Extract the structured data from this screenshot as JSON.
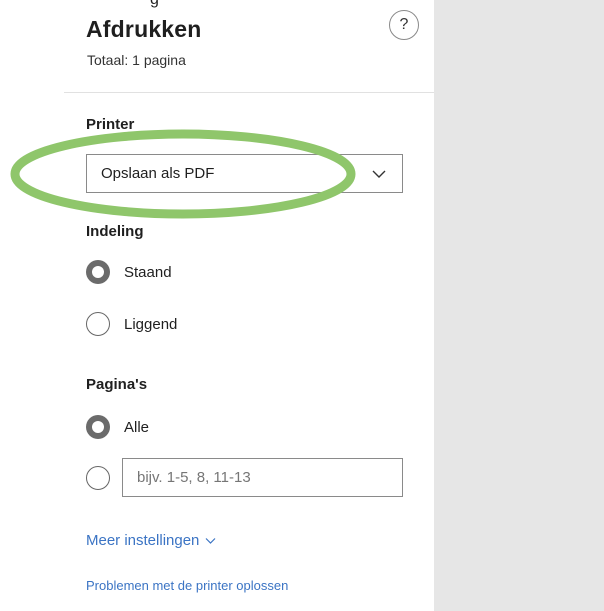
{
  "preview_pane": {},
  "clipped_text": "g",
  "header": {
    "title": "Afdrukken",
    "subtitle": "Totaal: 1 pagina",
    "help_glyph": "?"
  },
  "printer": {
    "label": "Printer",
    "selected": "Opslaan als PDF"
  },
  "layout": {
    "label": "Indeling",
    "options": [
      {
        "label": "Staand",
        "checked": true
      },
      {
        "label": "Liggend",
        "checked": false
      }
    ]
  },
  "pages": {
    "label": "Pagina's",
    "all_label": "Alle",
    "custom_placeholder": "bijv. 1-5, 8, 11-13",
    "custom_value": ""
  },
  "links": {
    "more_settings": "Meer instellingen",
    "troubleshoot": "Problemen met de printer oplossen"
  },
  "colors": {
    "accent": "#3b74c4",
    "highlight": "#8fc66b",
    "preview_bg": "#e6e6e6"
  },
  "icons": {
    "help": "question-circle-icon",
    "dropdown": "chevron-down-icon",
    "more": "chevron-down-icon"
  }
}
